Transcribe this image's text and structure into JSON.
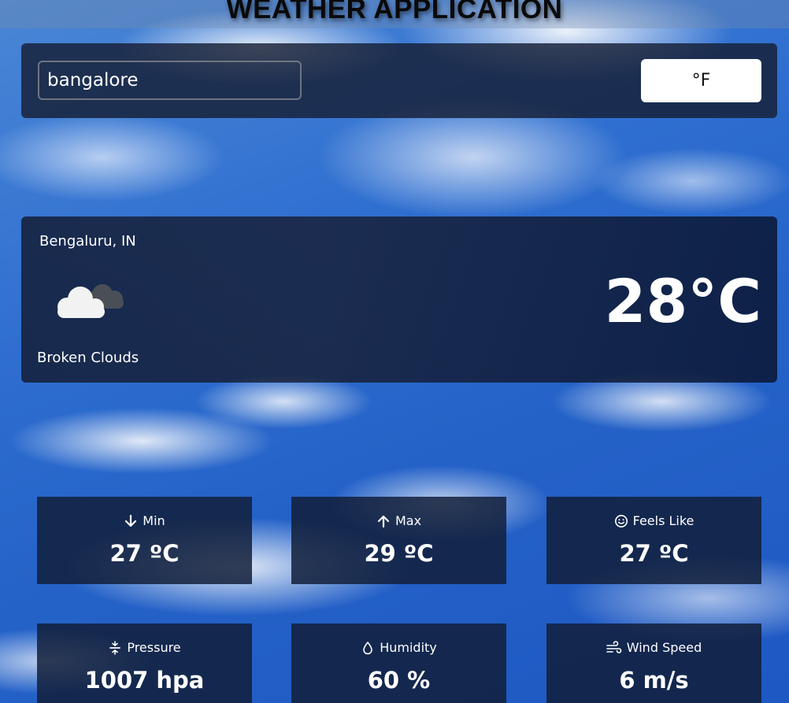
{
  "header": {
    "title": "WEATHER APPLICATION"
  },
  "search": {
    "value": "bangalore",
    "unit_toggle_label": "°F"
  },
  "current": {
    "location": "Bengaluru, IN",
    "condition": "Broken Clouds",
    "temperature": "28°C",
    "icon": "broken-clouds-icon"
  },
  "stats": [
    {
      "label": "Min",
      "value": "27 ºC",
      "icon": "arrow-down-icon"
    },
    {
      "label": "Max",
      "value": "29 ºC",
      "icon": "arrow-up-icon"
    },
    {
      "label": "Feels Like",
      "value": "27 ºC",
      "icon": "smiley-icon"
    },
    {
      "label": "Pressure",
      "value": "1007 hpa",
      "icon": "pressure-icon"
    },
    {
      "label": "Humidity",
      "value": "60 %",
      "icon": "droplet-icon"
    },
    {
      "label": "Wind Speed",
      "value": "6 m/s",
      "icon": "wind-icon"
    }
  ],
  "colors": {
    "panel": "#161e34",
    "card": "#121e3a",
    "text": "#ffffff",
    "button_bg": "#ffffff"
  }
}
